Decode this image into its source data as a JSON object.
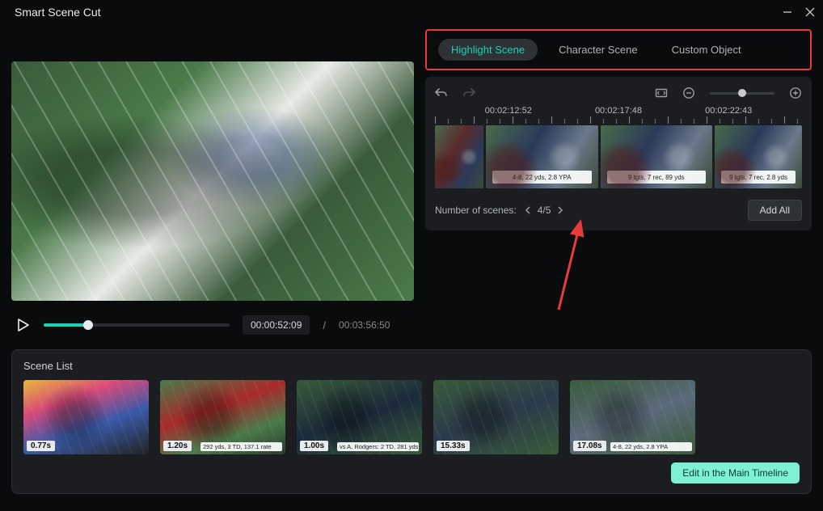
{
  "window": {
    "title": "Smart Scene Cut"
  },
  "tabs": {
    "highlight": "Highlight Scene",
    "character": "Character Scene",
    "custom": "Custom Object",
    "active": "highlight"
  },
  "preview": {
    "current_time": "00:00:52:09",
    "duration": "00:03:56:50",
    "slash": "/"
  },
  "timeline": {
    "labels": [
      "00:02:12:52",
      "00:02:17:48",
      "00:02:22:43"
    ],
    "clips": [
      {
        "caption": ""
      },
      {
        "caption": "4-8, 22 yds, 2.8 YPA"
      },
      {
        "caption": "9 tgts, 7 rec, 89 yds"
      },
      {
        "caption": "9 tgts, 7 rec, 2.8 yds"
      }
    ],
    "num_scenes_label": "Number of scenes:",
    "page": "4/5",
    "add_all": "Add All"
  },
  "scene_list": {
    "title": "Scene List",
    "items": [
      {
        "duration": "0.77s",
        "caption": ""
      },
      {
        "duration": "1.20s",
        "caption": "292 yds, 3 TD, 137.1 rate"
      },
      {
        "duration": "1.00s",
        "caption": "vs A. Rodgers: 2 TD, 281 yds"
      },
      {
        "duration": "15.33s",
        "caption": ""
      },
      {
        "duration": "17.08s",
        "caption": "4-8, 22 yds, 2.8 YPA"
      }
    ]
  },
  "footer": {
    "edit": "Edit in the Main Timeline"
  }
}
